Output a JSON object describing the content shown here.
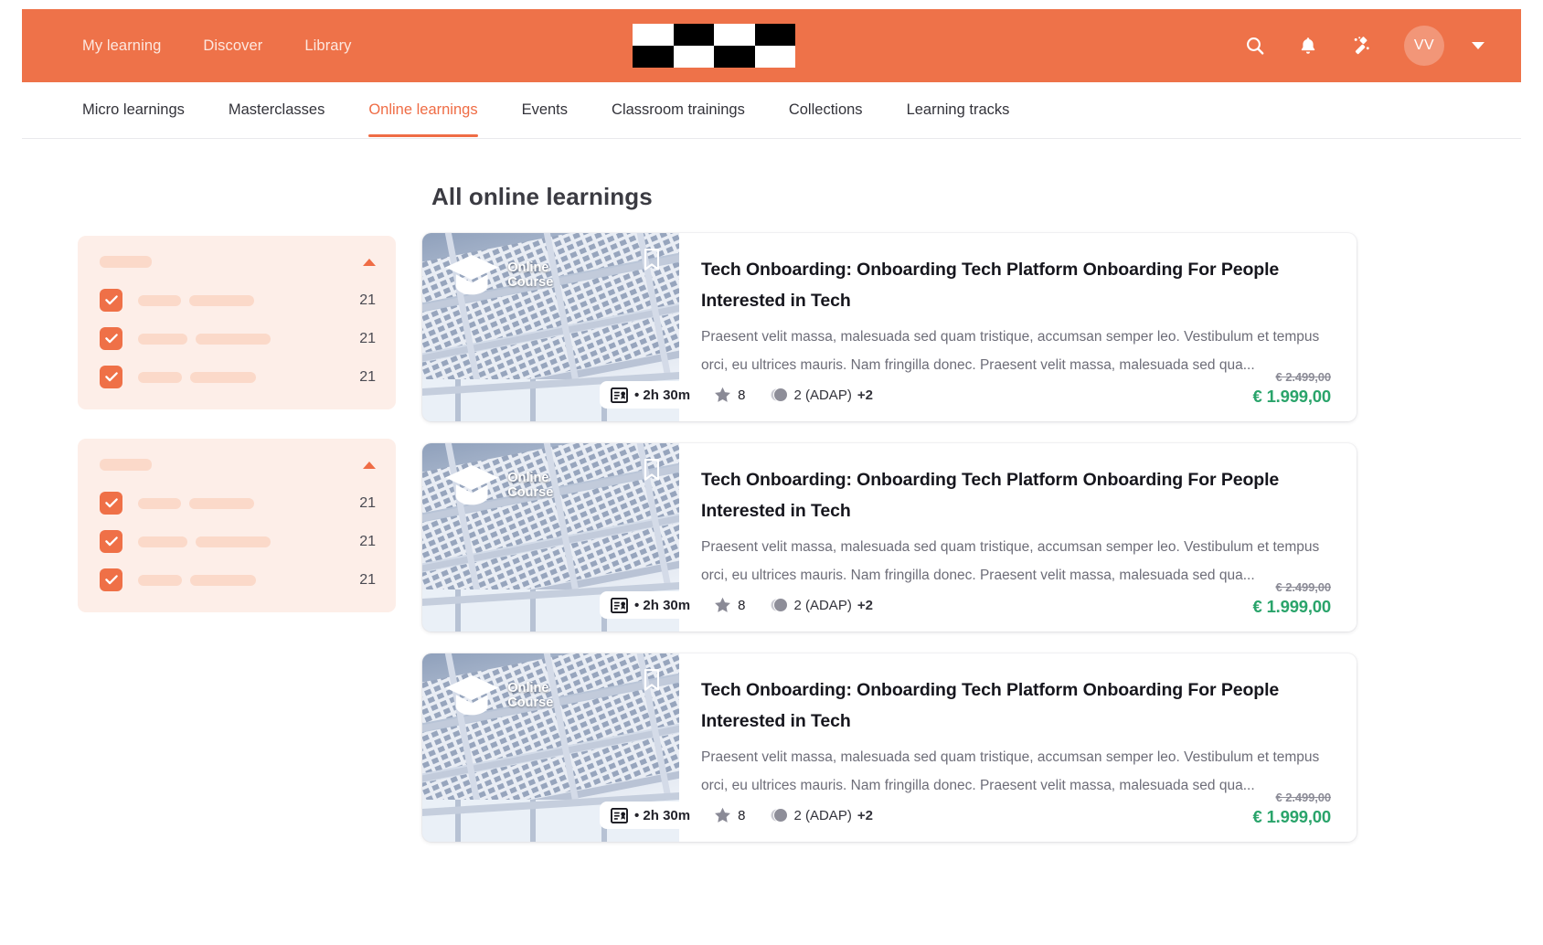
{
  "header": {
    "nav": [
      {
        "label": "My learning"
      },
      {
        "label": "Discover"
      },
      {
        "label": "Library"
      }
    ],
    "logo_alt": "checkerboard-logo",
    "icons": [
      {
        "name": "search-icon"
      },
      {
        "name": "bell-icon"
      },
      {
        "name": "magic-wand-icon"
      }
    ],
    "avatar_initials": "VV",
    "accent_color": "#ee7249"
  },
  "subtabs": [
    {
      "label": "Micro learnings",
      "active": false
    },
    {
      "label": "Masterclasses",
      "active": false
    },
    {
      "label": "Online learnings",
      "active": true
    },
    {
      "label": "Events",
      "active": false
    },
    {
      "label": "Classroom trainings",
      "active": false
    },
    {
      "label": "Collections",
      "active": false
    },
    {
      "label": "Learning tracks",
      "active": false
    }
  ],
  "main": {
    "title": "All online learnings"
  },
  "filters": {
    "groups": [
      {
        "title_placeholder": true,
        "collapse_icon": "caret-up-icon",
        "rows": [
          {
            "checked": true,
            "count": "21",
            "skeleton_widths": [
              47,
              71
            ]
          },
          {
            "checked": true,
            "count": "21",
            "skeleton_widths": [
              54,
              82
            ]
          },
          {
            "checked": true,
            "count": "21",
            "skeleton_widths": [
              48,
              72
            ]
          }
        ]
      },
      {
        "title_placeholder": true,
        "collapse_icon": "caret-up-icon",
        "rows": [
          {
            "checked": true,
            "count": "21",
            "skeleton_widths": [
              47,
              71
            ]
          },
          {
            "checked": true,
            "count": "21",
            "skeleton_widths": [
              54,
              82
            ]
          },
          {
            "checked": true,
            "count": "21",
            "skeleton_widths": [
              48,
              72
            ]
          }
        ]
      }
    ]
  },
  "cards": [
    {
      "badge": "Online Course",
      "badge_icon": "graduation-cap-icon",
      "bookmark_icon": "bookmark-icon",
      "title": "Tech Onboarding: Onboarding Tech Platform Onboarding For People Interested in Tech",
      "description": "Praesent velit massa, malesuada sed quam tristique, accumsan semper leo. Vestibulum et tempus orci, eu ultrices mauris. Nam fringilla donec. Praesent velit massa, malesuada sed qua...",
      "duration": "• 2h 30m",
      "duration_icon": "certificate-icon",
      "rating": "8",
      "rating_icon": "star-icon",
      "audience": "2 (ADAP)",
      "audience_extra": "+2",
      "price_old": "€ 2.499,00",
      "price_new": "€ 1.999,00"
    },
    {
      "badge": "Online Course",
      "badge_icon": "graduation-cap-icon",
      "bookmark_icon": "bookmark-icon",
      "title": "Tech Onboarding: Onboarding Tech Platform Onboarding For People Interested in Tech",
      "description": "Praesent velit massa, malesuada sed quam tristique, accumsan semper leo. Vestibulum et tempus orci, eu ultrices mauris. Nam fringilla donec. Praesent velit massa, malesuada sed qua...",
      "duration": "• 2h 30m",
      "duration_icon": "certificate-icon",
      "rating": "8",
      "rating_icon": "star-icon",
      "audience": "2 (ADAP)",
      "audience_extra": "+2",
      "price_old": "€ 2.499,00",
      "price_new": "€ 1.999,00"
    },
    {
      "badge": "Online Course",
      "badge_icon": "graduation-cap-icon",
      "bookmark_icon": "bookmark-icon",
      "title": "Tech Onboarding: Onboarding Tech Platform Onboarding For People Interested in Tech",
      "description": "Praesent velit massa, malesuada sed quam tristique, accumsan semper leo. Vestibulum et tempus orci, eu ultrices mauris. Nam fringilla donec. Praesent velit massa, malesuada sed qua...",
      "duration": "• 2h 30m",
      "duration_icon": "certificate-icon",
      "rating": "8",
      "rating_icon": "star-icon",
      "audience": "2 (ADAP)",
      "audience_extra": "+2",
      "price_old": "€ 2.499,00",
      "price_new": "€ 1.999,00"
    }
  ],
  "colors": {
    "accent": "#ee7249",
    "price_green": "#2aa46b",
    "filter_bg": "#fdeee8",
    "skeleton": "#fbd9c9"
  }
}
